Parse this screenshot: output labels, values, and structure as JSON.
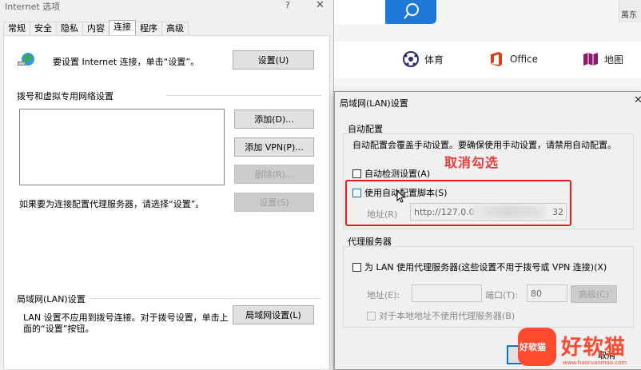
{
  "internet_options": {
    "title": "Internet 选项",
    "help": "?",
    "close": "✕",
    "tabs": [
      "常规",
      "安全",
      "隐私",
      "内容",
      "连接",
      "程序",
      "高级"
    ],
    "active_tab": "连接",
    "setup_text": "要设置 Internet 连接，单击“设置”。",
    "setup_button": "设置(U)",
    "dialup_group": "拨号和虚拟专用网络设置",
    "add_button": "添加(D)...",
    "add_vpn_button": "添加 VPN(P)...",
    "remove_button": "删除(R)...",
    "proxy_hint": "如果要为连接配置代理服务器，请选择“设置”。",
    "settings_button": "设置(S)",
    "lan_group": "局域网(LAN)设置",
    "lan_text_1": "LAN 设置不应用到拨号连接。对于拨号设置，单击上",
    "lan_text_2": "面的“设置”按钮。",
    "lan_button": "局域网设置(L)"
  },
  "lan_dialog": {
    "title": "局域网(LAN)设置",
    "close": "✕",
    "auto_config_group": "自动配置",
    "auto_config_desc": "自动配置会覆盖手动设置。要确保使用手动设置，请禁用自动配置。",
    "auto_detect": "自动检测设置(A)",
    "use_script": "使用自动配置脚本(S)",
    "address_label": "地址(R)",
    "address_value_start": "http://127.0.0",
    "address_value_end": "32",
    "proxy_group": "代理服务器",
    "use_proxy": "为 LAN 使用代理服务器(这些设置不用于拨号或 VPN 连接)(X)",
    "proxy_address_label": "地址(E):",
    "proxy_port_label": "端口(T):",
    "proxy_port_value": "80",
    "advanced_button": "高级(C)",
    "bypass_local": "对于本地地址不使用代理服务器(B)",
    "cancel": "取消"
  },
  "annotation": "取消勾选",
  "browser_bg": {
    "shortcut_sports": "体育",
    "shortcut_office": "Office",
    "shortcut_map": "地图",
    "top_right": "萬东"
  },
  "watermark": {
    "icon_text": "好软猫",
    "text": "好软猫",
    "url": "www.haoruanmao.com"
  },
  "colors": {
    "accent": "#0078d7",
    "annotation_red": "#e02020",
    "watermark": "#ff4a30"
  }
}
